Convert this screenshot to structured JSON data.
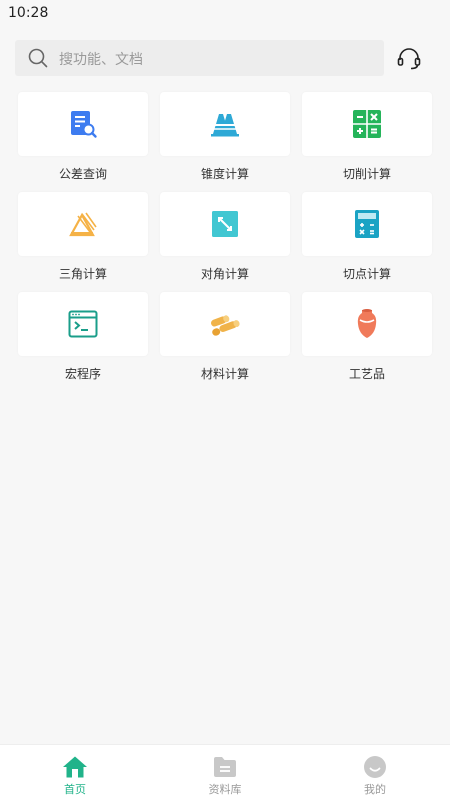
{
  "status_bar": {
    "time": "10:28"
  },
  "search": {
    "placeholder": "搜功能、文档",
    "icon": "search-icon"
  },
  "header": {
    "support_icon": "headset-icon"
  },
  "tools": [
    {
      "label": "公差查询",
      "icon": "document-search-icon",
      "color": "#3d7cf0"
    },
    {
      "label": "锥度计算",
      "icon": "taper-icon",
      "color": "#2ea9d6"
    },
    {
      "label": "切削计算",
      "icon": "math-operations-icon",
      "color": "#25b45a"
    },
    {
      "label": "三角计算",
      "icon": "triangle-icon",
      "color": "#f5b246"
    },
    {
      "label": "对角计算",
      "icon": "diagonal-icon",
      "color": "#41c7d2"
    },
    {
      "label": "切点计算",
      "icon": "calculator-icon",
      "color": "#1aa3c4"
    },
    {
      "label": "宏程序",
      "icon": "terminal-icon",
      "color": "#1a9e8a"
    },
    {
      "label": "材料计算",
      "icon": "material-bars-icon",
      "color": "#f0b34a"
    },
    {
      "label": "工艺品",
      "icon": "vase-icon",
      "color": "#f07a5a"
    }
  ],
  "bottom_nav": [
    {
      "label": "首页",
      "icon": "home-icon",
      "active": true
    },
    {
      "label": "资料库",
      "icon": "folder-icon",
      "active": false
    },
    {
      "label": "我的",
      "icon": "profile-icon",
      "active": false
    }
  ],
  "colors": {
    "accent": "#21b38a",
    "inactive": "#c8c8c8"
  }
}
